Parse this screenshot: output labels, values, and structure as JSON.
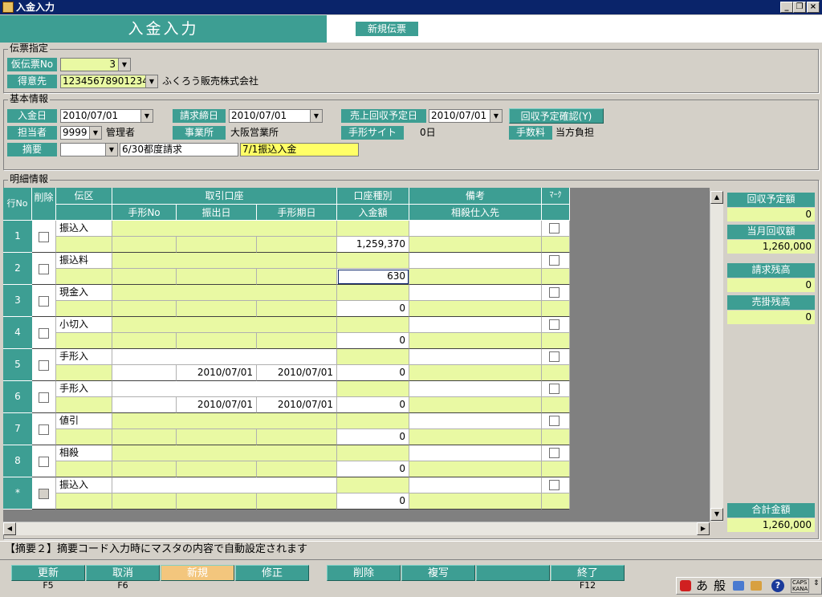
{
  "window": {
    "title": "入金入力"
  },
  "header": {
    "title": "入金入力",
    "badge": "新規伝票"
  },
  "voucher": {
    "group_title": "伝票指定",
    "temp_no_label": "仮伝票No",
    "temp_no_value": "3",
    "customer_label": "得意先",
    "customer_code": "12345678901234",
    "customer_name": "ふくろう販売株式会社"
  },
  "basic": {
    "group_title": "基本情報",
    "deposit_date_label": "入金日",
    "deposit_date": "2010/07/01",
    "closing_date_label": "請求締日",
    "closing_date": "2010/07/01",
    "sales_collect_label": "売上回収予定日",
    "sales_collect_date": "2010/07/01",
    "confirm_button": "回収予定確認(Y)",
    "staff_label": "担当者",
    "staff_code": "9999",
    "staff_name": "管理者",
    "office_label": "事業所",
    "office_name": "大阪営業所",
    "note_site_label": "手形サイト",
    "note_site_value": "0日",
    "fee_label": "手数料",
    "fee_value": "当方負担",
    "summary_label": "摘要",
    "summary_code": "",
    "summary_text1": "6/30都度請求",
    "summary_text2": "7/1振込入金"
  },
  "detail": {
    "group_title": "明細情報",
    "headers": {
      "row_no": "行No",
      "delete": "削除",
      "type": "伝区",
      "account": "取引口座",
      "note_no": "手形No",
      "issue_date": "振出日",
      "due_date": "手形期日",
      "account_type": "口座種別",
      "amount": "入金額",
      "remarks": "備考",
      "offset_supplier": "相殺仕入先",
      "mark": "ﾏｰｸ"
    },
    "rows": [
      {
        "no": "1",
        "type": "振込入",
        "issue": "",
        "due": "",
        "amount": "1,259,370"
      },
      {
        "no": "2",
        "type": "振込料",
        "issue": "",
        "due": "",
        "amount": "630"
      },
      {
        "no": "3",
        "type": "現金入",
        "issue": "",
        "due": "",
        "amount": "0"
      },
      {
        "no": "4",
        "type": "小切入",
        "issue": "",
        "due": "",
        "amount": "0"
      },
      {
        "no": "5",
        "type": "手形入",
        "issue": "2010/07/01",
        "due": "2010/07/01",
        "amount": "0"
      },
      {
        "no": "6",
        "type": "手形入",
        "issue": "2010/07/01",
        "due": "2010/07/01",
        "amount": "0"
      },
      {
        "no": "7",
        "type": "値引",
        "issue": "",
        "due": "",
        "amount": "0"
      },
      {
        "no": "8",
        "type": "相殺",
        "issue": "",
        "due": "",
        "amount": "0"
      },
      {
        "no": "*",
        "type": "振込入",
        "issue": "",
        "due": "",
        "amount": "0"
      }
    ]
  },
  "side": {
    "collect_plan_label": "回収予定額",
    "collect_plan_value": "0",
    "month_collect_label": "当月回収額",
    "month_collect_value": "1,260,000",
    "billing_balance_label": "請求残高",
    "billing_balance_value": "0",
    "receivable_balance_label": "売掛残高",
    "receivable_balance_value": "0",
    "total_label": "合計金額",
    "total_value": "1,260,000"
  },
  "status": {
    "message": "【摘要２】摘要コード入力時にマスタの内容で自動設定されます"
  },
  "fkeys": [
    {
      "label": "更新",
      "key": "F5"
    },
    {
      "label": "取消",
      "key": "F6"
    },
    {
      "label": "新規",
      "key": ""
    },
    {
      "label": "修正",
      "key": ""
    },
    {
      "label": "削除",
      "key": ""
    },
    {
      "label": "複写",
      "key": ""
    },
    {
      "label": "",
      "key": ""
    },
    {
      "label": "終了",
      "key": "F12"
    }
  ],
  "ime": {
    "mode": "あ",
    "dict": "般",
    "caps": "CAPS",
    "kana": "KANA"
  }
}
